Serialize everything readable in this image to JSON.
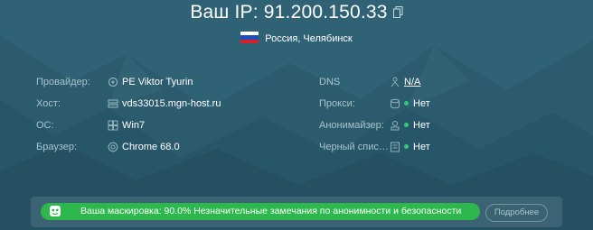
{
  "header": {
    "ip_label": "Ваш IP: 91.200.150.33",
    "location": "Россия, Челябинск",
    "copy_icon": "copy-icon",
    "flag_icon": "russia-flag-icon"
  },
  "info_left": [
    {
      "label": "Провайдер:",
      "value": "PE Viktor Tyurin",
      "icon": "provider-icon"
    },
    {
      "label": "Хост:",
      "value": "vds33015.mgn-host.ru",
      "icon": "host-icon"
    },
    {
      "label": "ОС:",
      "value": "Win7",
      "icon": "windows-icon"
    },
    {
      "label": "Браузер:",
      "value": "Chrome 68.0",
      "icon": "browser-icon"
    }
  ],
  "info_right": [
    {
      "label": "DNS",
      "value": "N/A",
      "icon": "dns-icon"
    },
    {
      "label": "Прокси:",
      "value": "Нет",
      "icon": "proxy-icon"
    },
    {
      "label": "Анонимайзер:",
      "value": "Нет",
      "icon": "anonymizer-icon"
    },
    {
      "label": "Черный спис…",
      "value": "Нет",
      "icon": "blacklist-icon"
    }
  ],
  "mask": {
    "text": "Ваша маскировка: 90.0% Незначительные замечания по анонимности и безопасности",
    "percent": 90.0,
    "icon": "mask-icon",
    "more_label": "Подробнее"
  },
  "colors": {
    "background": "#2d5f72",
    "accent_green": "#2db84d",
    "status_green": "#2ecc71",
    "label_gray": "#a8c4cf"
  }
}
